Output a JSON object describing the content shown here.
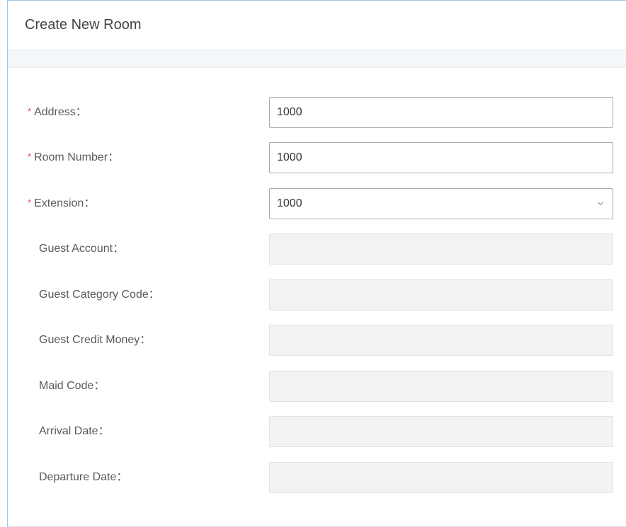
{
  "dialog": {
    "title": "Create New Room"
  },
  "form": {
    "address": {
      "label": "Address",
      "colon": "：",
      "value": "1000",
      "required": true
    },
    "room_number": {
      "label": "Room Number",
      "colon": "：",
      "value": "1000",
      "required": true
    },
    "extension": {
      "label": "Extension",
      "colon": "：",
      "value": "1000",
      "required": true
    },
    "guest_account": {
      "label": "Guest Account",
      "colon": "：",
      "value": ""
    },
    "guest_category_code": {
      "label": "Guest Category Code",
      "colon": "：",
      "value": ""
    },
    "guest_credit_money": {
      "label": "Guest Credit Money",
      "colon": "：",
      "value": ""
    },
    "maid_code": {
      "label": "Maid Code",
      "colon": "：",
      "value": ""
    },
    "arrival_date": {
      "label": "Arrival Date",
      "colon": "：",
      "value": ""
    },
    "departure_date": {
      "label": "Departure Date",
      "colon": "：",
      "value": ""
    }
  },
  "required_marker": "*",
  "icons": {
    "extension_dropdown": "chevron-down-icon"
  },
  "colors": {
    "required": "#e8474a",
    "border_accent": "#9ec7e7"
  }
}
